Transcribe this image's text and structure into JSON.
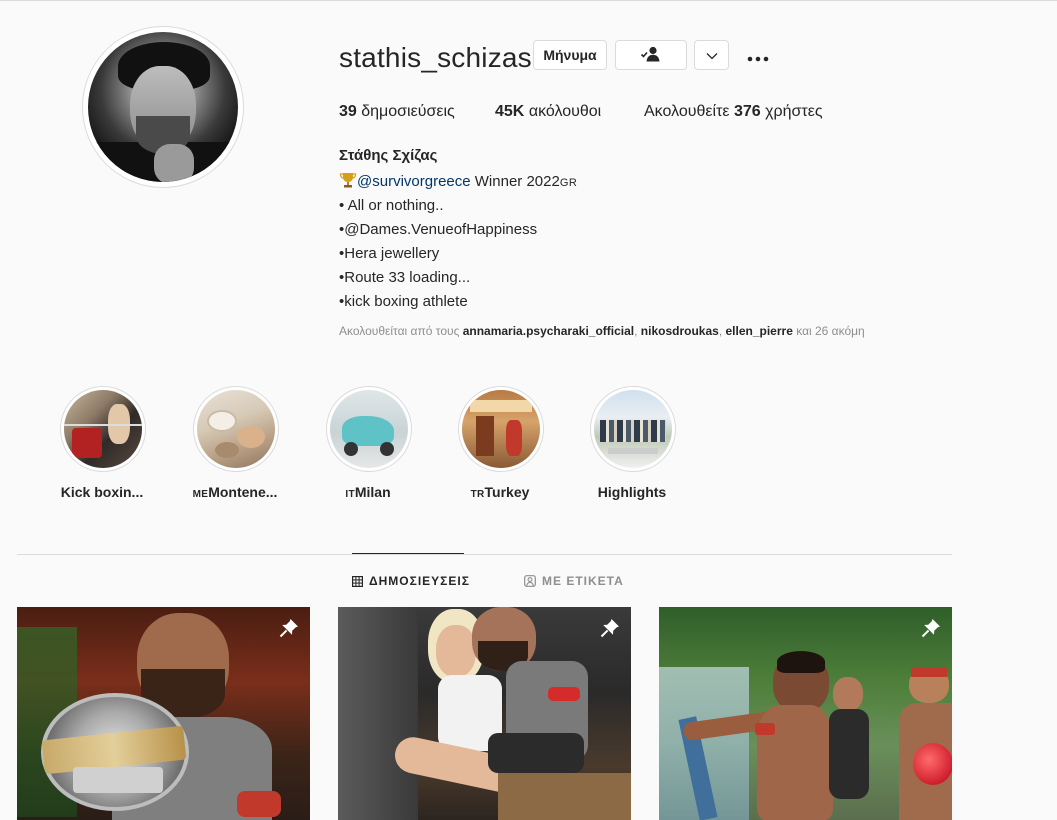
{
  "profile": {
    "username": "stathis_schizas",
    "buttons": {
      "message": "Μήνυμα"
    },
    "stats": {
      "posts_count": "39",
      "posts_label": "δημοσιεύσεις",
      "followers_count": "45K",
      "followers_label": "ακόλουθοι",
      "following_prefix": "Ακολουθείτε",
      "following_count": "376",
      "following_label": "χρήστες"
    },
    "full_name": "Στάθης Σχίζας",
    "bio": {
      "line1_mention": "@survivorgreece",
      "line1_text": " Winner 2022",
      "line1_flag": "GR",
      "line2": "• All or nothing..",
      "line3": "•@Dames.VenueofHappiness",
      "line4": "•Hera jewellery",
      "line5": "•Route 33 loading...",
      "line6": "•kick boxing athlete"
    },
    "followed_by": {
      "prefix": "Ακολουθείται από τους ",
      "user1": "annamaria.psycharaki_official",
      "sep1": ", ",
      "user2": "nikosdroukas",
      "sep2": ", ",
      "user3": "ellen_pierre",
      "suffix": " και 26 ακόμη"
    }
  },
  "highlights": [
    {
      "flag": "",
      "label": "Kick boxin..."
    },
    {
      "flag": "ME",
      "label": "Montene..."
    },
    {
      "flag": "IT",
      "label": "Milan"
    },
    {
      "flag": "TR",
      "label": "Turkey"
    },
    {
      "flag": "",
      "label": "Highlights"
    }
  ],
  "tabs": {
    "posts": "ΔΗΜΟΣΙΕΥΣΕΙΣ",
    "tagged": "ΜΕ ΕΤΙΚΕΤΑ"
  },
  "posts": [
    {
      "pinned": true
    },
    {
      "pinned": true
    },
    {
      "pinned": true
    }
  ],
  "icons": {
    "following": "person-check-icon",
    "dropdown": "chevron-down-icon",
    "more": "more-horizontal-icon",
    "posts_tab": "grid-icon",
    "tagged_tab": "tag-person-icon",
    "pin": "pin-icon",
    "trophy": "trophy-icon"
  },
  "colors": {
    "background": "#fafafa",
    "text": "#262626",
    "secondary": "#8e8e8e",
    "mention": "#00376b",
    "border": "#dbdbdb"
  }
}
